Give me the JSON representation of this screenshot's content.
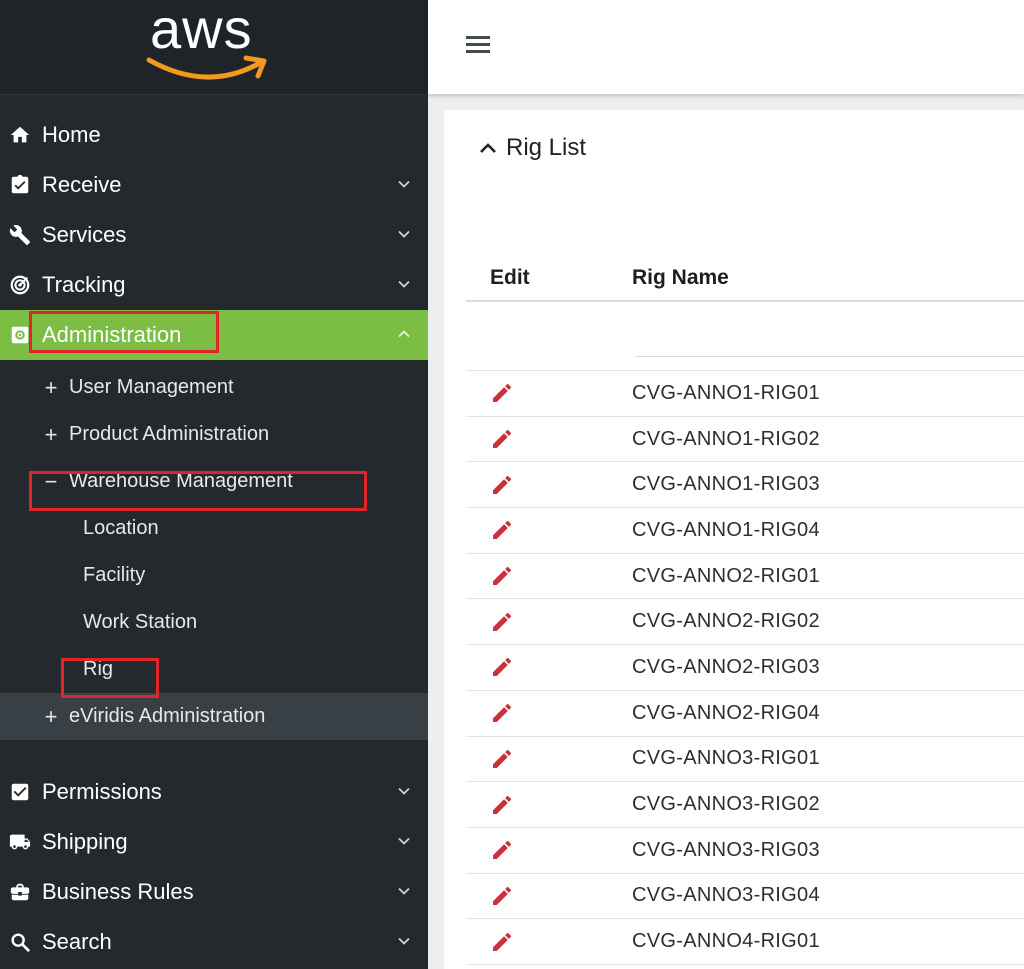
{
  "brand": {
    "logo_text": "aws",
    "accent_color": "#f29a1f"
  },
  "sidebar": {
    "active_color": "#7cbd43",
    "items_top": [
      {
        "label": "Home",
        "icon": "home-icon",
        "has_chevron": false
      },
      {
        "label": "Receive",
        "icon": "clipboard-check-icon",
        "has_chevron": true
      },
      {
        "label": "Services",
        "icon": "wrench-icon",
        "has_chevron": true
      },
      {
        "label": "Tracking",
        "icon": "radar-icon",
        "has_chevron": true
      },
      {
        "label": "Administration",
        "icon": "admin-gear-icon",
        "has_chevron": true,
        "active": true
      }
    ],
    "admin_sub": [
      {
        "label": "User Management",
        "marker": "+"
      },
      {
        "label": "Product Administration",
        "marker": "+"
      },
      {
        "label": "Warehouse Management",
        "marker": "−"
      }
    ],
    "warehouse_sub": [
      {
        "label": "Location"
      },
      {
        "label": "Facility"
      },
      {
        "label": "Work Station"
      },
      {
        "label": "Rig"
      }
    ],
    "eviridis": {
      "label": "eViridis Administration",
      "marker": "+"
    },
    "items_bottom": [
      {
        "label": "Permissions",
        "icon": "checkbox-icon",
        "has_chevron": true
      },
      {
        "label": "Shipping",
        "icon": "truck-icon",
        "has_chevron": true
      },
      {
        "label": "Business Rules",
        "icon": "briefcase-icon",
        "has_chevron": true
      },
      {
        "label": "Search",
        "icon": "search-icon",
        "has_chevron": true
      }
    ]
  },
  "main": {
    "card_title": "Rig List",
    "table": {
      "columns": [
        "Edit",
        "Rig Name"
      ],
      "edit_icon_color": "#c8323a",
      "rows": [
        "CVG-ANNO1-RIG01",
        "CVG-ANNO1-RIG02",
        "CVG-ANNO1-RIG03",
        "CVG-ANNO1-RIG04",
        "CVG-ANNO2-RIG01",
        "CVG-ANNO2-RIG02",
        "CVG-ANNO2-RIG03",
        "CVG-ANNO2-RIG04",
        "CVG-ANNO3-RIG01",
        "CVG-ANNO3-RIG02",
        "CVG-ANNO3-RIG03",
        "CVG-ANNO3-RIG04",
        "CVG-ANNO4-RIG01"
      ]
    }
  }
}
